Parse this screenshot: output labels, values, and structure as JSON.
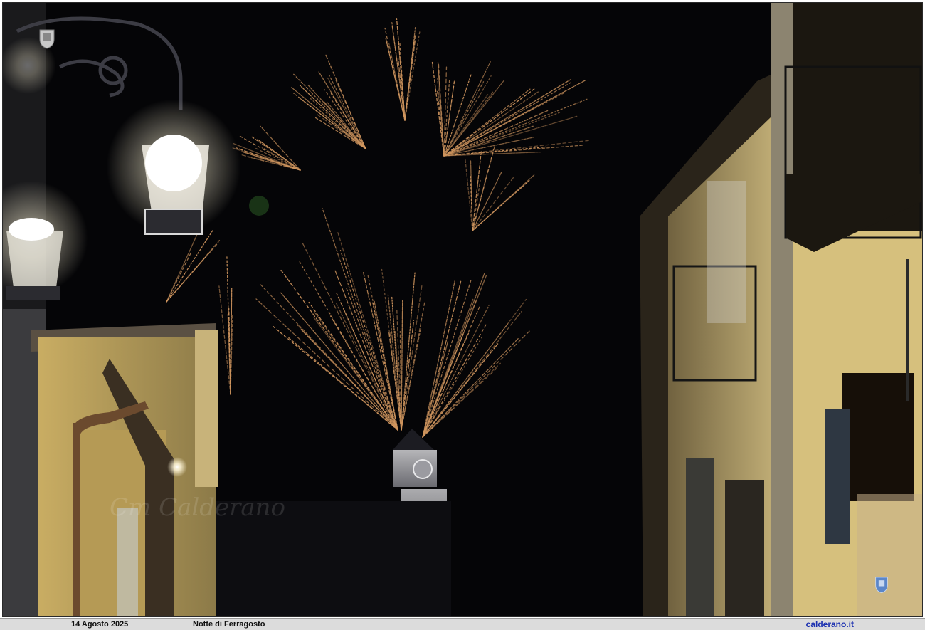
{
  "photo": {
    "subject": "fireworks",
    "watermark_seal_top_left": "crest-seal",
    "watermark_seal_bottom_right": "crest-seal"
  },
  "caption": {
    "date": "14 Agosto 2025",
    "title": "Notte di Ferragosto",
    "site": "calderano.it"
  },
  "colors": {
    "sky": "#050507",
    "wall_yellow": "#d9c07a",
    "spark_gold": "#f0b070",
    "lamp_glow": "#fffbe8",
    "site_link": "#1a2fb0",
    "caption_bg": "#dcdcdc"
  }
}
